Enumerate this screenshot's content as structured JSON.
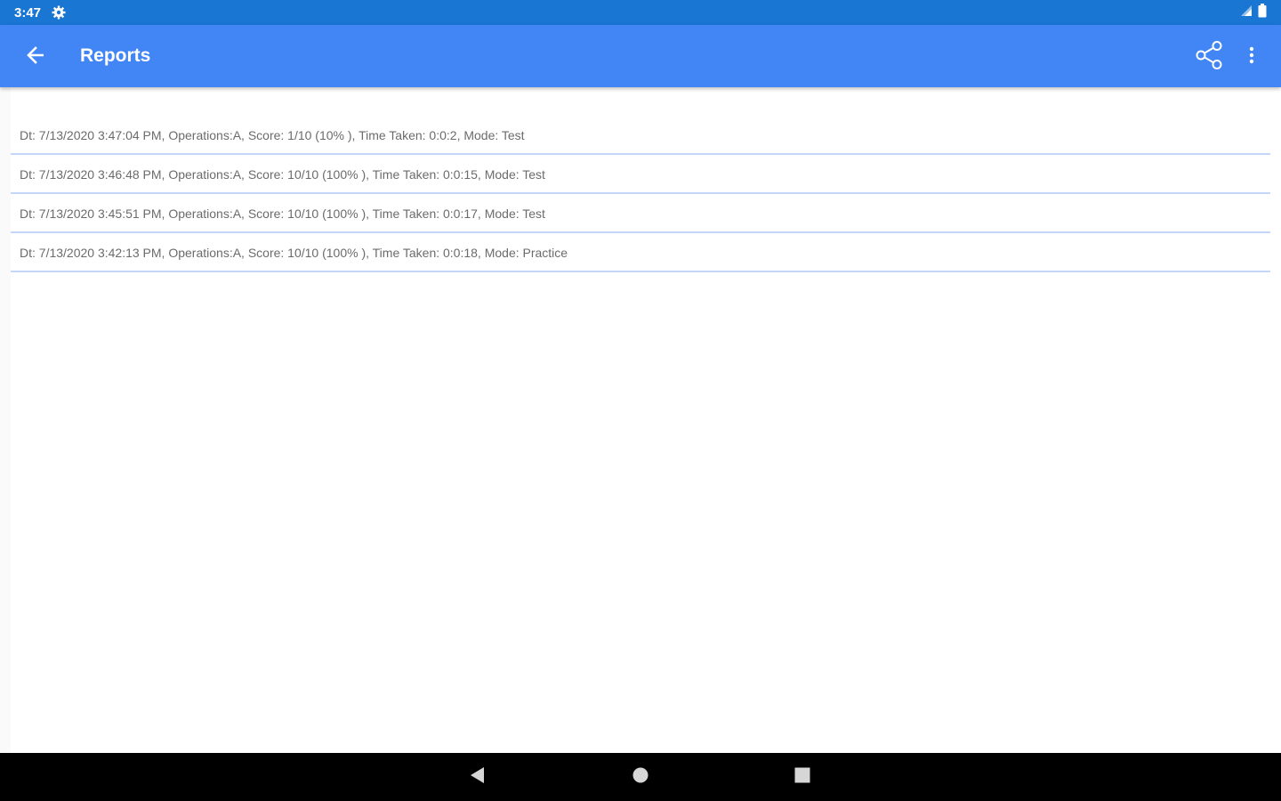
{
  "status_bar": {
    "time": "3:47",
    "settings_icon": "gear-icon",
    "signal_icon": "signal-icon",
    "battery_icon": "battery-icon"
  },
  "app_bar": {
    "title": "Reports",
    "back_icon": "arrow-left-icon",
    "share_icon": "share-icon",
    "more_icon": "more-vert-icon",
    "color": "#4285f4"
  },
  "reports": [
    {
      "text": "Dt: 7/13/2020 3:47:04 PM, Operations:A, Score: 1/10 (10% ), Time Taken: 0:0:2, Mode: Test"
    },
    {
      "text": "Dt: 7/13/2020 3:46:48 PM, Operations:A, Score: 10/10 (100% ), Time Taken: 0:0:15, Mode: Test"
    },
    {
      "text": "Dt: 7/13/2020 3:45:51 PM, Operations:A, Score: 10/10 (100% ), Time Taken: 0:0:17, Mode: Test"
    },
    {
      "text": "Dt: 7/13/2020 3:42:13 PM, Operations:A, Score: 10/10 (100% ), Time Taken: 0:0:18, Mode: Practice"
    }
  ],
  "nav_bar": {
    "back_icon": "nav-back-icon",
    "home_icon": "nav-home-icon",
    "recents_icon": "nav-recents-icon"
  }
}
